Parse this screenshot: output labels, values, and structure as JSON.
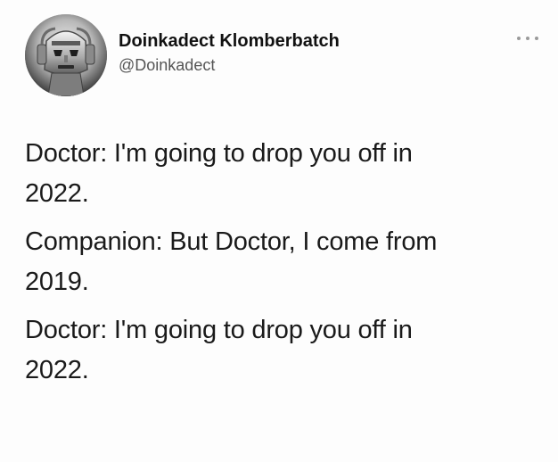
{
  "author": {
    "display_name": "Doinkadect Klomberbatch",
    "handle": "@Doinkadect",
    "avatar_icon": "cyberman-avatar"
  },
  "more_icon": "more-dots-icon",
  "tweet_lines": [
    [
      "Doctor: I'm going to drop you off in",
      "2022."
    ],
    [
      "Companion: But Doctor, I come from",
      "2019."
    ],
    [
      "Doctor: I'm going to drop you off in",
      "2022."
    ]
  ],
  "colors": {
    "text": "#1a1a1a",
    "handle": "#555555",
    "background": "#fdfdfd"
  }
}
